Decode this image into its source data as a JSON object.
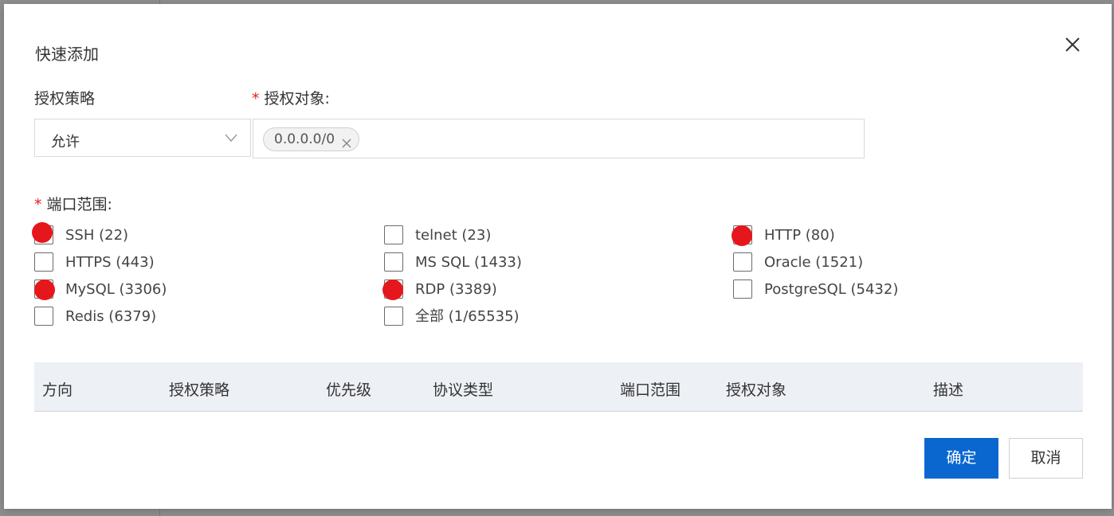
{
  "dialog": {
    "title": "快速添加",
    "policy_label": "授权策略",
    "policy_value": "允许",
    "target_label": "授权对象:",
    "target_tags": [
      "0.0.0.0/0"
    ],
    "port_label": "端口范围:",
    "required_mark": "*"
  },
  "ports": [
    {
      "label": "SSH (22)",
      "checked": true
    },
    {
      "label": "telnet (23)",
      "checked": false
    },
    {
      "label": "HTTP (80)",
      "checked": true
    },
    {
      "label": "HTTPS (443)",
      "checked": false
    },
    {
      "label": "MS SQL (1433)",
      "checked": false
    },
    {
      "label": "Oracle (1521)",
      "checked": false
    },
    {
      "label": "MySQL (3306)",
      "checked": true
    },
    {
      "label": "RDP (3389)",
      "checked": true
    },
    {
      "label": "PostgreSQL (5432)",
      "checked": false
    },
    {
      "label": "Redis (6379)",
      "checked": false
    },
    {
      "label": "全部 (1/65535)",
      "checked": false
    }
  ],
  "table": {
    "headers": [
      "方向",
      "授权策略",
      "优先级",
      "协议类型",
      "端口范围",
      "授权对象",
      "描述"
    ]
  },
  "buttons": {
    "confirm": "确定",
    "cancel": "取消"
  },
  "colors": {
    "primary": "#0a67d0",
    "required": "#e02020",
    "marker": "#e6171c",
    "table_header_bg": "#edf0f5"
  }
}
